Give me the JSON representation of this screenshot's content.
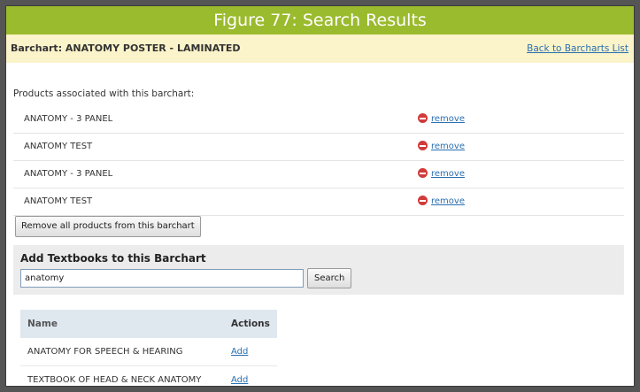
{
  "figure_title": "Figure 77: Search Results",
  "barchart": {
    "title": "Barchart: ANATOMY POSTER - LAMINATED",
    "back_link": "Back to Barcharts List"
  },
  "associated": {
    "label": "Products associated with this barchart:",
    "products": [
      {
        "name": "ANATOMY - 3 PANEL",
        "action": "remove"
      },
      {
        "name": "ANATOMY TEST",
        "action": "remove"
      },
      {
        "name": "ANATOMY - 3 PANEL",
        "action": "remove"
      },
      {
        "name": "ANATOMY TEST",
        "action": "remove"
      }
    ],
    "remove_all_label": "Remove all products from this barchart"
  },
  "add_textbooks": {
    "heading": "Add Textbooks to this Barchart",
    "search_value": "anatomy",
    "search_button": "Search"
  },
  "results": {
    "columns": [
      "Name",
      "Actions"
    ],
    "rows": [
      {
        "name": "ANATOMY FOR SPEECH & HEARING",
        "action": "Add"
      },
      {
        "name": "TEXTBOOK OF HEAD & NECK ANATOMY",
        "action": "Add"
      }
    ]
  },
  "colors": {
    "title_bar": "#9bbb2e",
    "barchart_bar": "#fbf3c9",
    "link": "#2a6fb0",
    "remove_icon": "#d13b3b"
  },
  "icons": {
    "remove": "remove-icon"
  }
}
